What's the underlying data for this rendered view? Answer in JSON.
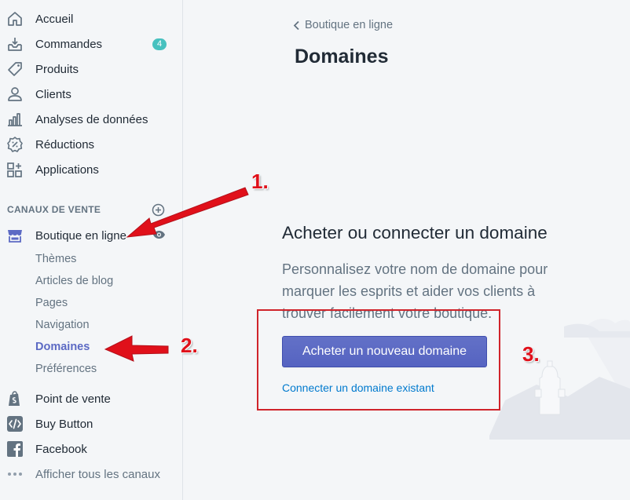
{
  "sidebar": {
    "items": [
      {
        "label": "Accueil",
        "icon": "home-icon"
      },
      {
        "label": "Commandes",
        "icon": "orders-icon",
        "badge": "4"
      },
      {
        "label": "Produits",
        "icon": "tag-icon"
      },
      {
        "label": "Clients",
        "icon": "person-icon"
      },
      {
        "label": "Analyses de données",
        "icon": "bar-chart-icon"
      },
      {
        "label": "Réductions",
        "icon": "discount-icon"
      },
      {
        "label": "Applications",
        "icon": "apps-icon"
      }
    ],
    "channels_title": "CANAUX DE VENTE",
    "online_store": {
      "label": "Boutique en ligne",
      "subitems": [
        "Thèmes",
        "Articles de blog",
        "Pages",
        "Navigation",
        "Domaines",
        "Préférences"
      ],
      "active": "Domaines"
    },
    "channels": [
      {
        "label": "Point de vente",
        "icon": "shopify-bag-icon"
      },
      {
        "label": "Buy Button",
        "icon": "code-icon"
      },
      {
        "label": "Facebook",
        "icon": "facebook-icon"
      },
      {
        "label": "Afficher tous les canaux",
        "icon": "more-dots-icon"
      }
    ]
  },
  "main": {
    "breadcrumb": "Boutique en ligne",
    "title": "Domaines",
    "empty_state": {
      "heading": "Acheter ou connecter un domaine",
      "description": "Personnalisez votre nom de domaine pour marquer les esprits et aider vos clients à trouver facilement votre boutique.",
      "primary_action": "Acheter un nouveau domaine",
      "secondary_action": "Connecter un domaine existant"
    }
  },
  "annotations": {
    "step1": "1.",
    "step2": "2.",
    "step3": "3."
  },
  "colors": {
    "accent": "#5c6ac4",
    "badge": "#47c1bf",
    "link": "#007ace",
    "annotation": "#e0101a"
  }
}
